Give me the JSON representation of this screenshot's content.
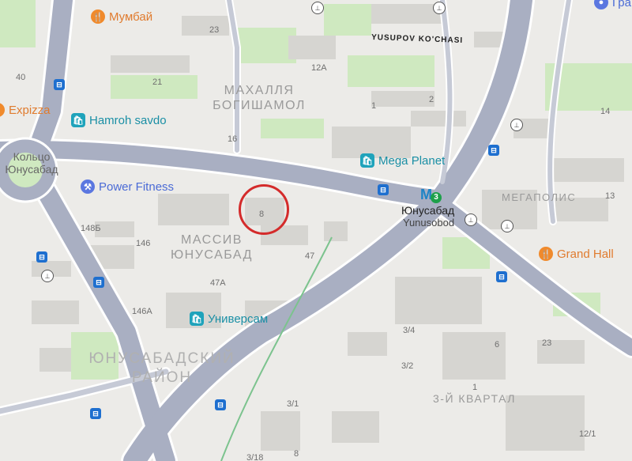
{
  "map": {
    "house_numbers": [
      "23",
      "12А",
      "40",
      "21",
      "1",
      "2",
      "16",
      "14",
      "8",
      "13",
      "148Б",
      "146",
      "47",
      "47А",
      "146А",
      "3/4",
      "6",
      "23",
      "3/2",
      "1",
      "3/1",
      "3/18",
      "8",
      "12/1"
    ],
    "districts": {
      "bogishamol_line1": "МАХАЛЛЯ",
      "bogishamol_line2": "БОГИШАМОЛ",
      "yunusabad_massiv_line1": "МАССИВ",
      "yunusabad_massiv_line2": "ЮНУСАБАД",
      "rayon_line1": "ЮНУСАБАДСКИЙ",
      "rayon_line2": "РАЙОН",
      "kvartal": "3-Й КВАРТАЛ",
      "megapolis": "МЕГАПОЛИС",
      "koltso_line1": "Кольцо",
      "koltso_line2": "Юнусабад"
    },
    "street_label": "YUSUPOV KO'CHASI",
    "pois": {
      "mumbai": "Мумбай",
      "expizza": "Expizza",
      "hamroh": "Hamroh savdo",
      "power_fitness": "Power Fitness",
      "mega_planet": "Mega Planet",
      "grand_hall": "Grand Hall",
      "universam": "Универсам",
      "top_right_cut": "Гра"
    },
    "metro": {
      "symbol": "M",
      "line_number": "3",
      "name_ru": "Юнусабад",
      "name_uz": "Yunusobod"
    },
    "colors": {
      "road": "#a9afc2",
      "road_edge": "#ffffff",
      "park": "#cfe9c0",
      "building": "#d6d5d1",
      "highlight": "#d42b2b",
      "metro": "#1c84c6",
      "metro_line": "#1ea04a",
      "bus_stop": "#1e6fcf"
    }
  }
}
